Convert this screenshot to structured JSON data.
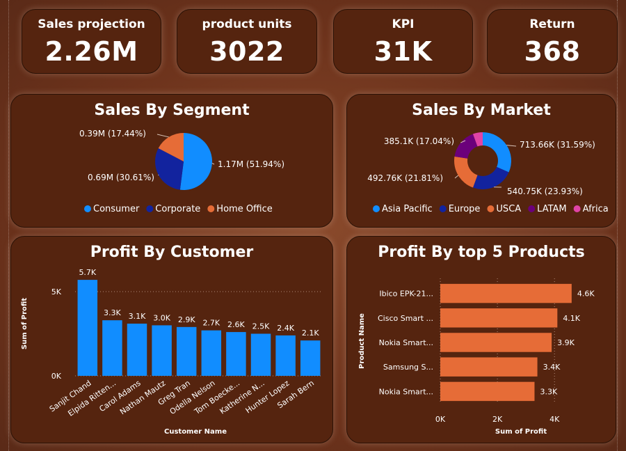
{
  "kpis": [
    {
      "title": "Sales projection",
      "value": "2.26M"
    },
    {
      "title": "product units",
      "value": "3022"
    },
    {
      "title": "KPI",
      "value": "31K"
    },
    {
      "title": "Return",
      "value": "368"
    }
  ],
  "colors": {
    "card_bg": "#55240f",
    "blue": "#118dff",
    "navy": "#12239e",
    "orange": "#e66c37",
    "purple": "#6b007b",
    "pink": "#e044a7",
    "bar_orange": "#e66c37"
  },
  "chart_data": [
    {
      "type": "pie",
      "title": "Sales By Segment",
      "categories": [
        "Consumer",
        "Corporate",
        "Home Office"
      ],
      "values": [
        1.17,
        0.69,
        0.39
      ],
      "data_labels": [
        "1.17M (51.94%)",
        "0.69M (30.61%)",
        "0.39M (17.44%)"
      ],
      "colors": [
        "#118dff",
        "#12239e",
        "#e66c37"
      ],
      "legend": "bottom"
    },
    {
      "type": "pie",
      "subtype": "donut",
      "title": "Sales By Market",
      "categories": [
        "Asia Pacific",
        "Europe",
        "USCA",
        "LATAM",
        "Africa"
      ],
      "values": [
        713.66,
        540.75,
        492.76,
        385.1,
        126.0
      ],
      "data_labels": [
        "713.66K (31.59%)",
        "540.75K (23.93%)",
        "492.76K (21.81%)",
        "385.1K (17.04%)",
        ""
      ],
      "colors": [
        "#118dff",
        "#12239e",
        "#e66c37",
        "#6b007b",
        "#e044a7"
      ],
      "legend": "bottom"
    },
    {
      "type": "bar",
      "title": "Profit By Customer",
      "categories": [
        "Sanjit Chand",
        "Elpida Ritten...",
        "Carol Adams",
        "Nathan Mautz",
        "Greg Tran",
        "Odella Nelson",
        "Tom Boecke...",
        "Katherine N...",
        "Hunter Lopez",
        "Sarah Bern"
      ],
      "values": [
        5.7,
        3.3,
        3.1,
        3.0,
        2.9,
        2.7,
        2.6,
        2.5,
        2.4,
        2.1
      ],
      "data_labels": [
        "5.7K",
        "3.3K",
        "3.1K",
        "3.0K",
        "2.9K",
        "2.7K",
        "2.6K",
        "2.5K",
        "2.4K",
        "2.1K"
      ],
      "xlabel": "Customer Name",
      "ylabel": "Sum of Profit",
      "y_ticks": [
        "0K",
        "5K"
      ],
      "ylim": [
        0,
        6.2
      ],
      "color": "#118dff"
    },
    {
      "type": "bar",
      "orientation": "horizontal",
      "title": "Profit By top 5 Products",
      "categories": [
        "Ibico EPK-21...",
        "Cisco Smart ...",
        "Nokia Smart...",
        "Samsung S...",
        "Nokia Smart..."
      ],
      "values": [
        4.6,
        4.1,
        3.9,
        3.4,
        3.3
      ],
      "data_labels": [
        "4.6K",
        "4.1K",
        "3.9K",
        "3.4K",
        "3.3K"
      ],
      "xlabel": "Sum of Profit",
      "ylabel": "Product Name",
      "x_ticks": [
        "0K",
        "2K",
        "4K"
      ],
      "xlim": [
        0,
        4.75
      ],
      "color": "#e66c37"
    }
  ]
}
